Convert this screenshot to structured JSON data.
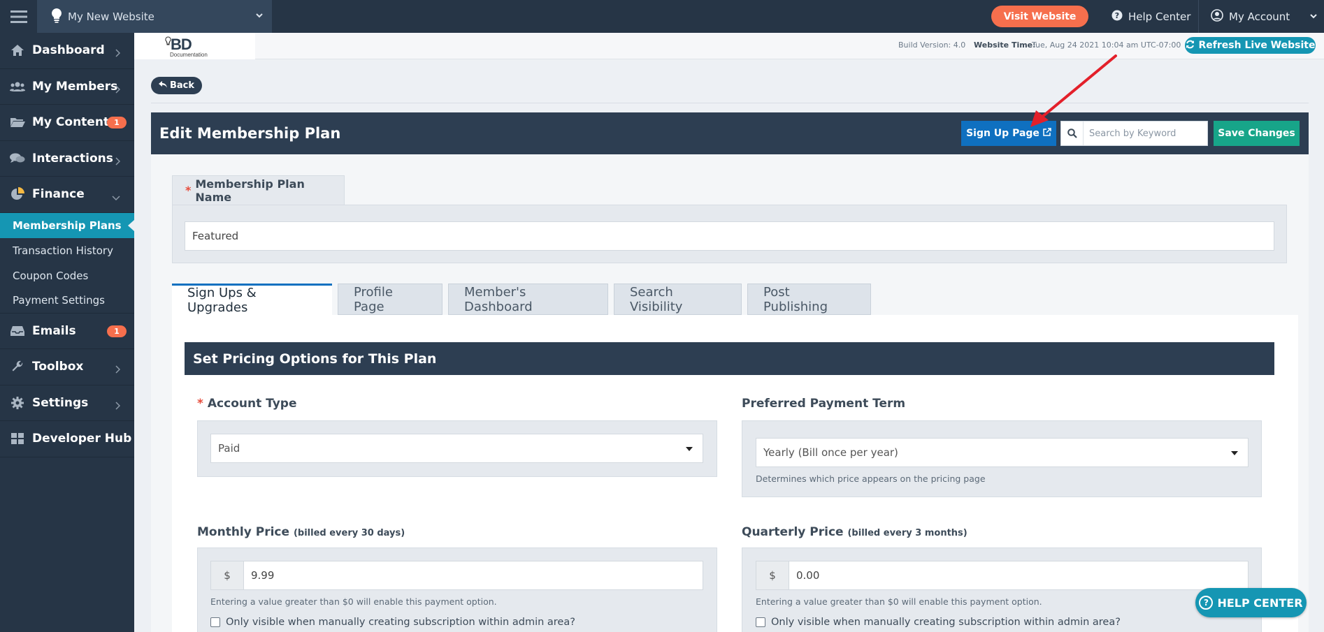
{
  "topbar": {
    "site_name": "My New Website",
    "visit_label": "Visit Website",
    "help_label": "Help Center",
    "account_label": "My Account"
  },
  "sidebar": {
    "items": [
      {
        "label": "Dashboard",
        "icon": "home-icon"
      },
      {
        "label": "My Members",
        "icon": "users-icon"
      },
      {
        "label": "My Content",
        "icon": "folder-icon",
        "badge": "1"
      },
      {
        "label": "Interactions",
        "icon": "comments-icon"
      },
      {
        "label": "Finance",
        "icon": "pie-chart-icon"
      }
    ],
    "finance_sub": [
      {
        "label": "Membership Plans",
        "active": true
      },
      {
        "label": "Transaction History"
      },
      {
        "label": "Coupon Codes"
      },
      {
        "label": "Payment Settings"
      }
    ],
    "items_after": [
      {
        "label": "Emails",
        "icon": "inbox-icon",
        "badge": "1"
      },
      {
        "label": "Toolbox",
        "icon": "wrench-icon"
      },
      {
        "label": "Settings",
        "icon": "gear-icon"
      },
      {
        "label": "Developer Hub",
        "icon": "grid-icon"
      }
    ]
  },
  "subheader": {
    "logo_text": "BD",
    "logo_sub": "Documentation",
    "build": "Build Version: 4.0",
    "website_time_label": "Website Time:",
    "website_time": "Tue, Aug 24 2021 10:04 am UTC-07:00",
    "refresh_label": "Refresh Live Website"
  },
  "back_label": "Back",
  "header": {
    "title": "Edit Membership Plan",
    "signup_label": "Sign Up Page",
    "search_placeholder": "Search by Keyword",
    "save_label": "Save Changes"
  },
  "plan_name": {
    "label": "Membership Plan Name",
    "value": "Featured"
  },
  "tabs": [
    "Sign Ups & Upgrades",
    "Profile Page",
    "Member's Dashboard",
    "Search Visibility",
    "Post Publishing"
  ],
  "section_title": "Set Pricing Options for This Plan",
  "account_type": {
    "label": "Account Type",
    "value": "Paid"
  },
  "payment_term": {
    "label": "Preferred Payment Term",
    "value": "Yearly (Bill once per year)",
    "hint": "Determines which price appears on the pricing page"
  },
  "monthly": {
    "label": "Monthly Price",
    "sub": "(billed every 30 days)",
    "currency": "$",
    "value": "9.99",
    "hint": "Entering a value greater than $0 will enable this payment option.",
    "checkbox": "Only visible when manually creating subscription within admin area?"
  },
  "quarterly": {
    "label": "Quarterly Price",
    "sub": "(billed every 3 months)",
    "currency": "$",
    "value": "0.00",
    "hint": "Entering a value greater than $0 will enable this payment option.",
    "checkbox": "Only visible when manually creating subscription within admin area?"
  },
  "help_float_label": "HELP CENTER",
  "colors": {
    "sidebar": "#263546",
    "accent_teal": "#1596b3",
    "orange": "#f66f4d",
    "primary_blue": "#0f70c0",
    "green": "#17a589",
    "annotation_arrow": "#e3202a"
  }
}
